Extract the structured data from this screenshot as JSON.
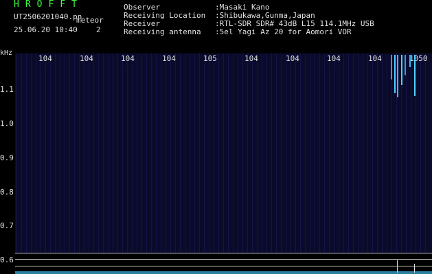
{
  "header": {
    "app_title": "HROFFT",
    "filename": "UT2506201040.pn",
    "filename_suffix": "meteor",
    "datetime": "25.06.20 10:40",
    "detections": "2",
    "observer_label": "Observer",
    "observer_value": ":Masaki Kano",
    "location_label": "Receiving Location",
    "location_value": ":Shibukawa,Gunma,Japan",
    "receiver_label": "Receiver",
    "receiver_value": ":RTL-SDR SDR# 43dB L15 114.1MHz USB",
    "antenna_label": "Receiving antenna",
    "antenna_value": ":5el Yagi Az 20 for Aomori VOR"
  },
  "axis": {
    "unit": "kHz",
    "x_ticks": [
      "104",
      "104",
      "104",
      "104",
      "105",
      "104",
      "104",
      "104",
      "104",
      "1050"
    ],
    "y_ticks": [
      "1.1",
      "1.0",
      "0.9",
      "0.8",
      "0.7",
      "0.6"
    ]
  },
  "colors": {
    "title": "#3cff3c",
    "text": "#e0e0e0",
    "background": "#0a0a2a",
    "meteor": "#4fd0ff"
  }
}
